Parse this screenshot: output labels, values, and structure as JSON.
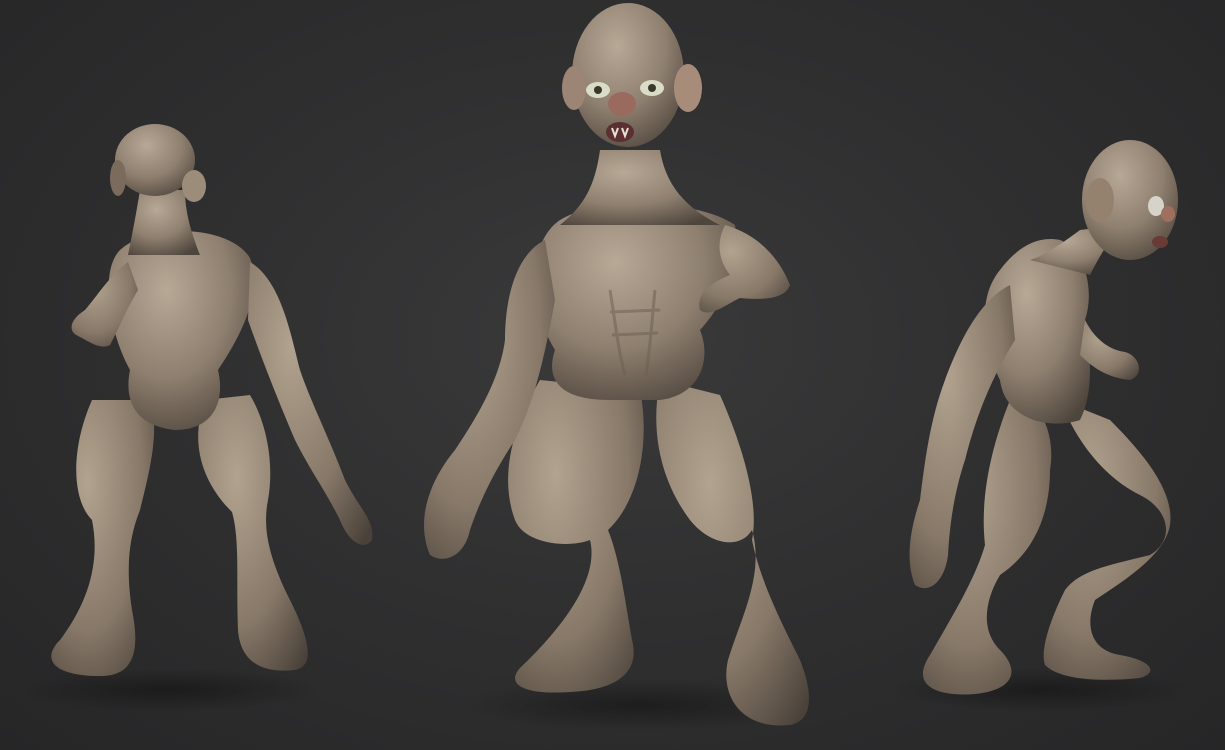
{
  "scene": {
    "background_color": "#2f2f30",
    "clay_color": "#8c7d6d",
    "figures": [
      {
        "view": "back"
      },
      {
        "view": "front"
      },
      {
        "view": "side"
      }
    ]
  }
}
